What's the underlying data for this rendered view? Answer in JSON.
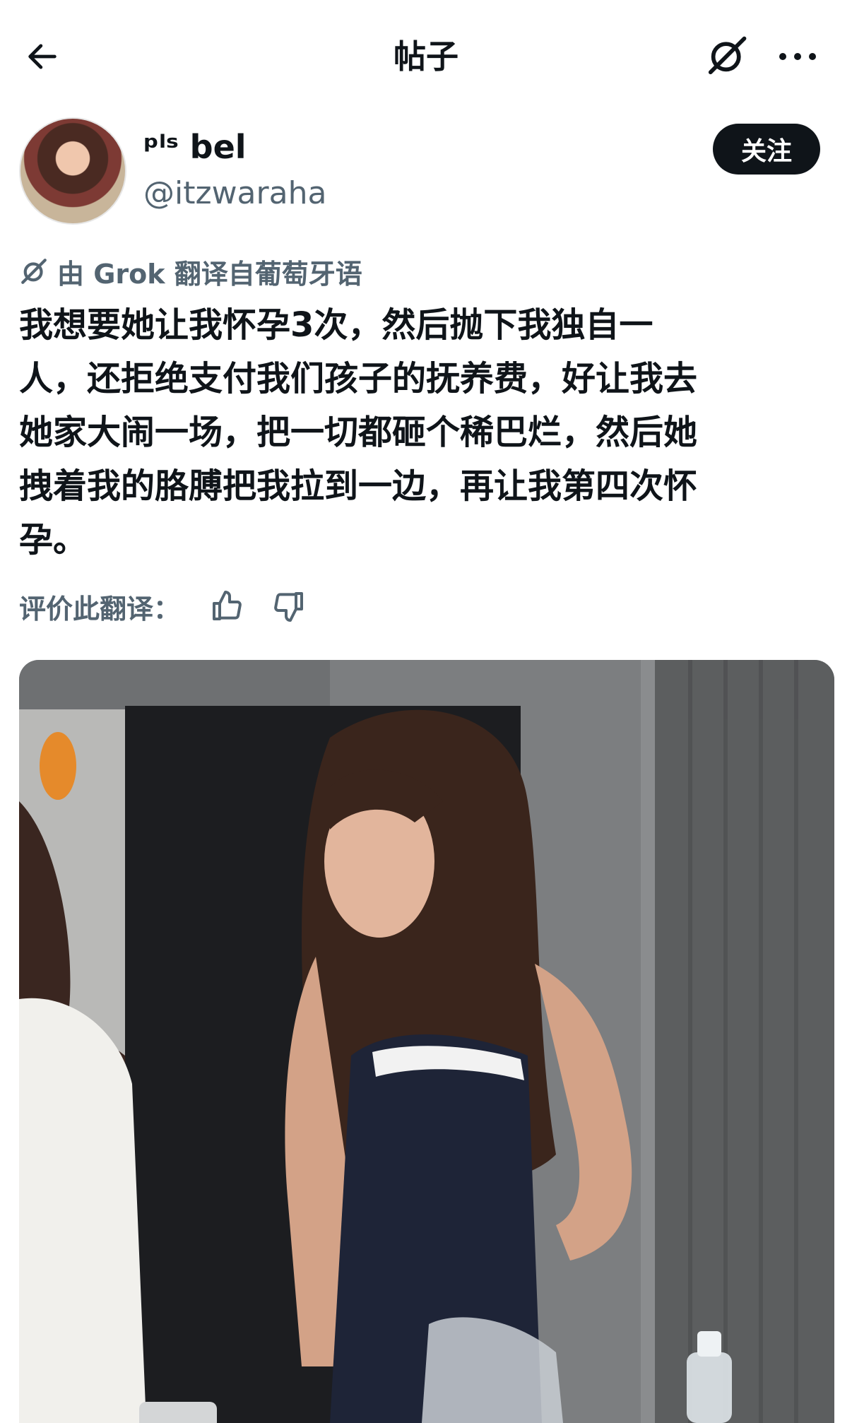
{
  "header": {
    "title": "帖子"
  },
  "author": {
    "display_name": "ᵖˡˢ bel",
    "handle": "@itzwaraha",
    "follow_label": "关注"
  },
  "translation": {
    "note": "由 Grok 翻译自葡萄牙语"
  },
  "post": {
    "text": "我想要她让我怀孕3次，然后抛下我独自一\n人，还拒绝支付我们孩子的抚养费，好让我去\n她家大闹一场，把一切都砸个稀巴烂，然后她\n拽着我的胳膊把我拉到一边，再让我第四次怀\n孕。"
  },
  "rating": {
    "label": "评价此翻译："
  },
  "icons": {
    "back": "arrow-left-icon",
    "grok": "grok-icon",
    "more": "more-dots-icon",
    "thumbs_up": "thumbs-up-icon",
    "thumbs_down": "thumbs-down-icon"
  },
  "colors": {
    "text_primary": "#0f1419",
    "text_secondary": "#536471",
    "follow_bg": "#0f1419",
    "follow_text": "#ffffff"
  }
}
